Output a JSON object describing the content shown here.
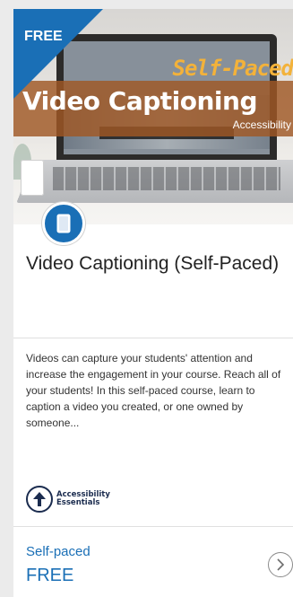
{
  "card": {
    "ribbon": "FREE",
    "banner": {
      "subtitle": "Self-Paced",
      "title": "Video Captioning",
      "tag": "Accessibility"
    },
    "icon": "document-icon",
    "title": "Video Captioning (Self-Paced)",
    "description": "Videos can capture your students' attention and increase the engagement in your course. Reach all of your students! In this self-paced course, learn to caption a video you created, or one owned by someone...",
    "logo": {
      "line1": "Accessibility",
      "line2": "Essentials",
      "icon": "accessibility-arrow-icon"
    },
    "pace": "Self-paced",
    "price": "FREE",
    "action_icon": "chevron-right-icon"
  },
  "colors": {
    "accent": "#1a6fb6",
    "band": "#a05824",
    "band_text": "#f3b23a"
  }
}
